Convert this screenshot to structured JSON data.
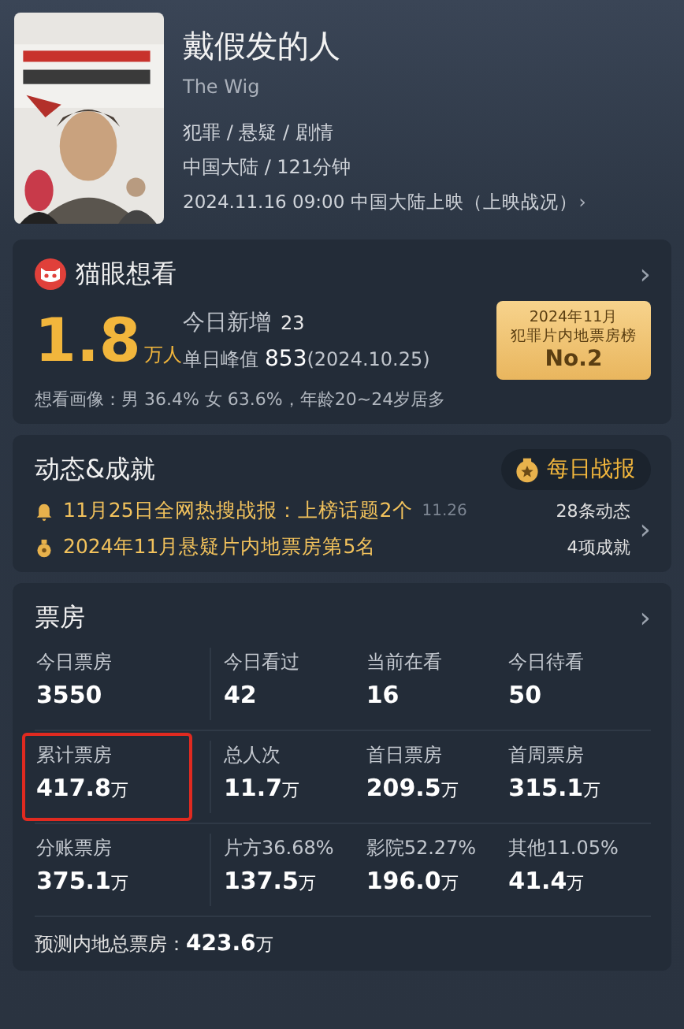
{
  "movie": {
    "title": "戴假发的人",
    "original_title": "The Wig",
    "genres": "犯罪 / 悬疑 / 剧情",
    "region_duration": "中国大陆 / 121分钟",
    "release": "2024.11.16 09:00 中国大陆上映（上映战况）",
    "release_arrow": "›"
  },
  "wish": {
    "title": "猫眼想看",
    "arrow": "›",
    "count": "1.8",
    "count_unit": "万人",
    "today_label": "今日新增",
    "today_value": "23",
    "peak_label": "单日峰值",
    "peak_value": "853",
    "peak_date": "(2024.10.25)",
    "badge": {
      "line1": "2024年11月",
      "line2": "犯罪片内地票房榜",
      "rank": "No.2"
    },
    "portrait": "想看画像：男 36.4%  女 63.6%，年龄20~24岁居多"
  },
  "news": {
    "title": "动态&成就",
    "daily_button": "每日战报",
    "arrow": "›",
    "items": [
      {
        "kind": "bell",
        "text": "11月25日全网热搜战报：上榜话题2个",
        "date": "11.26",
        "count": "28条动态"
      },
      {
        "kind": "medal",
        "text": "2024年11月悬疑片内地票房第5名",
        "count": "4项成就"
      }
    ]
  },
  "box_office": {
    "title": "票房",
    "arrow": "›",
    "rows": [
      [
        {
          "label": "今日票房",
          "value": "3550"
        },
        {
          "label": "今日看过",
          "value": "42"
        },
        {
          "label": "当前在看",
          "value": "16"
        },
        {
          "label": "今日待看",
          "value": "50"
        }
      ],
      [
        {
          "label": "累计票房",
          "value": "417.8",
          "unit": "万",
          "highlighted": true
        },
        {
          "label": "总人次",
          "value": "11.7",
          "unit": "万"
        },
        {
          "label": "首日票房",
          "value": "209.5",
          "unit": "万"
        },
        {
          "label": "首周票房",
          "value": "315.1",
          "unit": "万"
        }
      ],
      [
        {
          "label": "分账票房",
          "value": "375.1",
          "unit": "万"
        },
        {
          "label": "片方36.68%",
          "value": "137.5",
          "unit": "万"
        },
        {
          "label": "影院52.27%",
          "value": "196.0",
          "unit": "万"
        },
        {
          "label": "其他11.05%",
          "value": "41.4",
          "unit": "万"
        }
      ]
    ],
    "forecast_label": "预测内地总票房：",
    "forecast_value": "423.6",
    "forecast_unit": "万"
  }
}
